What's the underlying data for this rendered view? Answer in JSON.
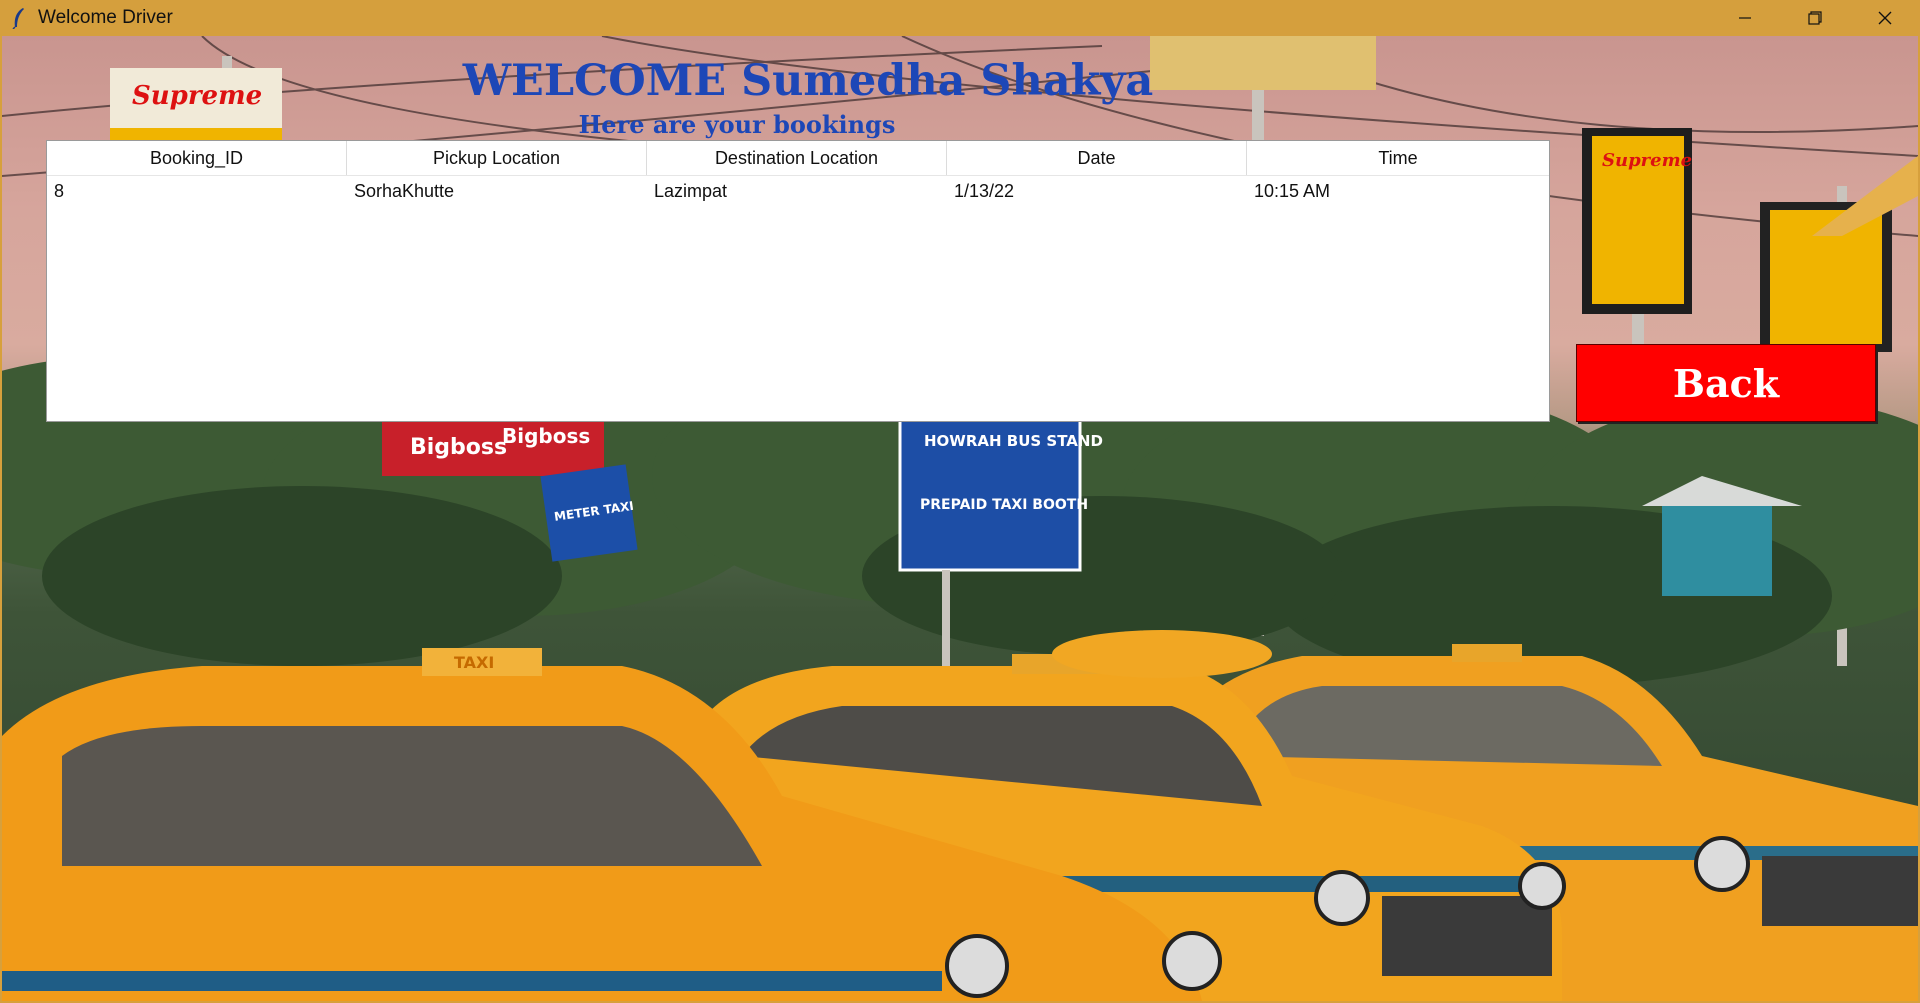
{
  "window": {
    "title": "Welcome Driver",
    "app_icon": "feather-icon",
    "controls": [
      "minimize-icon",
      "restore-icon",
      "close-icon"
    ]
  },
  "header": {
    "welcome": "WELCOME Sumedha Shakya",
    "subtitle": "Here are your bookings"
  },
  "bookings": {
    "columns": [
      "Booking_ID",
      "Pickup Location",
      "Destination Location",
      "Date",
      "Time"
    ],
    "rows": [
      [
        "8",
        "SorhaKhutte",
        "Lazimpat",
        "1/13/22",
        "10:15 AM"
      ]
    ]
  },
  "back_button": {
    "label": "Back"
  },
  "background": {
    "signs": {
      "supreme": "Supreme",
      "bigboss": "Bigboss",
      "meter_taxi": "METER TAXI",
      "howrah_bus_stand": "HOWRAH BUS STAND",
      "prepaid_taxi_booth": "PREPAID TAXI BOOTH",
      "taxi_roof": "TAXI"
    }
  },
  "colors": {
    "titlebar": "#d59f3d",
    "heading_blue": "#1d47b7",
    "back_red": "#ff0000",
    "taxi_yellow": "#f0a020"
  }
}
